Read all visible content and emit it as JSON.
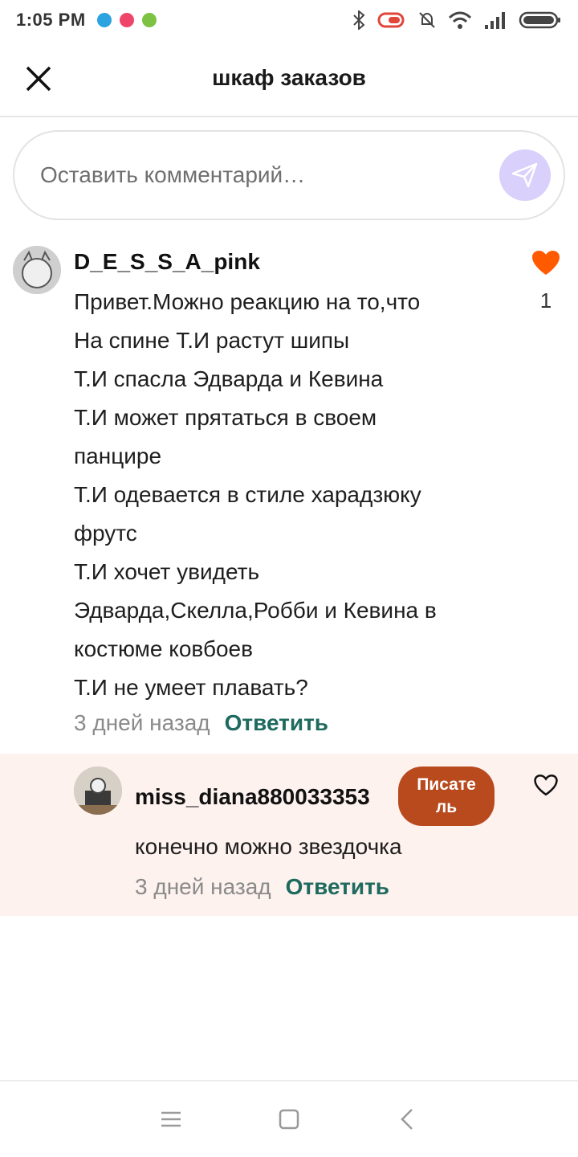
{
  "status_bar": {
    "time": "1:05 PM",
    "icons": [
      "telegram-icon",
      "music-icon",
      "android-icon",
      "bluetooth-icon",
      "battery-saver-icon",
      "mute-icon",
      "wifi-icon",
      "signal-icon",
      "battery-icon"
    ]
  },
  "header": {
    "title": "шкаф заказов",
    "close_icon": "close-icon"
  },
  "comment_input": {
    "placeholder": "Оставить комментарий…",
    "send_icon": "send-icon"
  },
  "comments": [
    {
      "username": "D_E_S_S_A_pink",
      "lines": [
        "Привет.Можно реакцию на то,что",
        "На спине Т.И растут шипы",
        "Т.И спасла Эдварда и Кевина",
        "Т.И может прятаться в своем",
        "панцире",
        "Т.И одевается в стиле харадзюку",
        "фрутс",
        "Т.И хочет увидеть",
        "Эдварда,Скелла,Робби и Кевина в",
        "костюме ковбоев",
        "Т.И не умеет плавать?"
      ],
      "time": "3 дней назад",
      "reply_label": "Ответить",
      "likes": "1",
      "liked": true
    }
  ],
  "reply": {
    "username": "miss_diana880033353",
    "badge": "Писате ль",
    "text": "конечно можно звездочка",
    "time": "3 дней назад",
    "reply_label": "Ответить",
    "liked": false
  },
  "colors": {
    "accent_green": "#1e6a5f",
    "heart_orange": "#ff5a00",
    "badge_brown": "#b84a1e",
    "send_bg": "#d9d0fb",
    "reply_bg": "#fdf2ee"
  },
  "nav": {
    "icons": [
      "menu-icon",
      "home-square-icon",
      "back-icon"
    ]
  }
}
